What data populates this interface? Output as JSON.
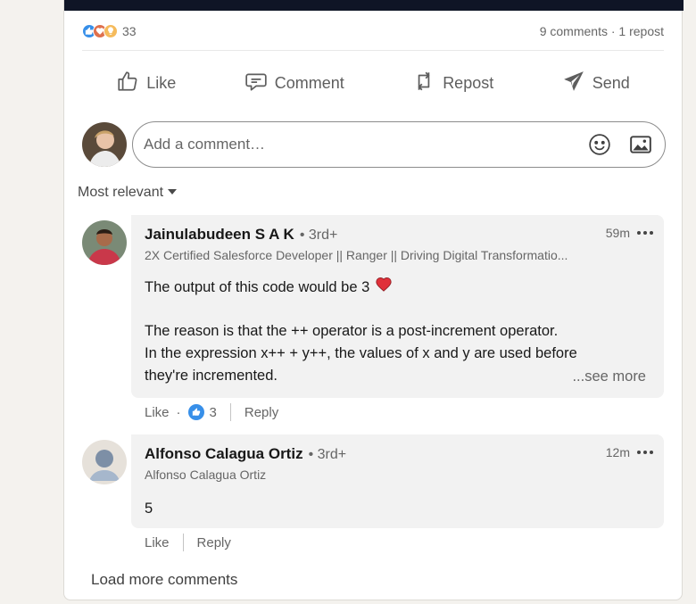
{
  "post_stats": {
    "reaction_count": "33",
    "comments_reposts": "9 comments · 1 repost"
  },
  "actions": {
    "like": "Like",
    "comment": "Comment",
    "repost": "Repost",
    "send": "Send"
  },
  "comment_box": {
    "placeholder": "Add a comment…"
  },
  "sort": {
    "label": "Most relevant"
  },
  "comments": [
    {
      "name": "Jainulabudeen S A K",
      "degree": "• 3rd+",
      "headline": "2X Certified Salesforce Developer || Ranger || Driving Digital Transformatio...",
      "time": "59m",
      "text_line1": "The output of this code would be 3",
      "text_line2": "The reason is that the ++ operator is a post-increment operator.",
      "text_line3": "In the expression x++ + y++, the values of x and y are used before",
      "text_line4": "they're incremented.",
      "see_more": "...see more",
      "like_label": "Like",
      "sep": "·",
      "likes": "3",
      "reply_label": "Reply"
    },
    {
      "name": "Alfonso Calagua Ortiz",
      "degree": "• 3rd+",
      "headline": "Alfonso Calagua Ortiz",
      "time": "12m",
      "text_line1": "5",
      "like_label": "Like",
      "reply_label": "Reply"
    }
  ],
  "load_more": "Load more comments",
  "colors": {
    "brand_blue": "#378fe9",
    "heart_red": "#e0313a",
    "dark_header": "#0f1526"
  }
}
